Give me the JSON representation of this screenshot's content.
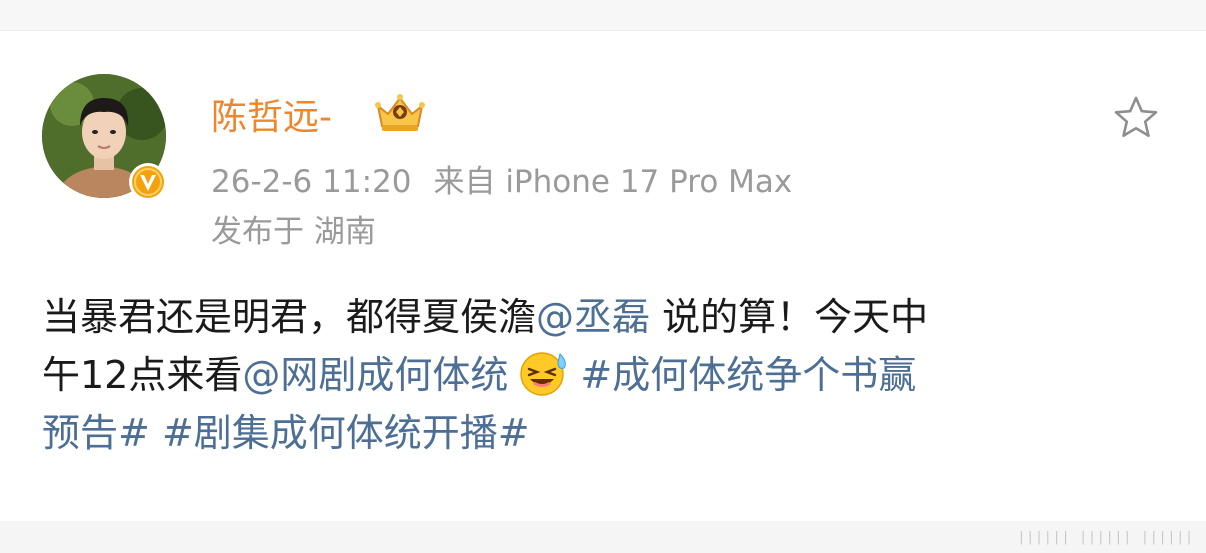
{
  "post": {
    "username": "陈哲远-",
    "timestamp": "26-2-6 11:20",
    "source": "来自 iPhone 17 Pro Max",
    "location": "发布于 湖南",
    "body": {
      "line1_text_a": "当暴君还是明君，都得夏侯澹",
      "line1_mention": "@丞磊",
      "line1_text_b": " 说的算！今天中",
      "line2_text_a": "午12点来看",
      "line2_mention": "@网剧成何体统",
      "line2_hashtag": "#成何体统争个书赢",
      "line3_hashtag_cont": "预告#",
      "line3_hashtag2": "#剧集成何体统开播#"
    },
    "icons": {
      "avatar": "user-avatar",
      "verified": "verified-badge-icon",
      "vip": "crown-icon",
      "favorite": "star-icon",
      "emoji": "laughing-emoji-icon"
    }
  },
  "colors": {
    "username": "#f0862b",
    "meta": "#9a9a9a",
    "link": "#4d6f96",
    "text": "#1a1a1a"
  }
}
